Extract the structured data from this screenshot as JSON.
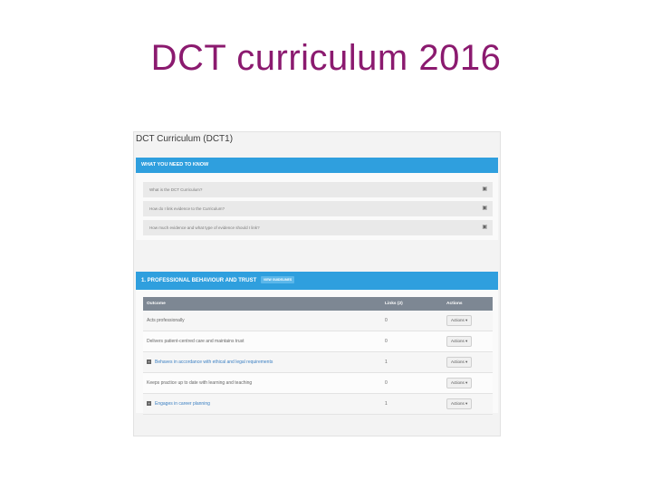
{
  "slide": {
    "title": "DCT curriculum 2016"
  },
  "page": {
    "heading": "DCT Curriculum (DCT1)"
  },
  "section1": {
    "title": "WHAT YOU NEED TO KNOW",
    "items": [
      {
        "label": "What is the DCT Curriculum?"
      },
      {
        "label": "How do I link evidence to the Curriculum?"
      },
      {
        "label": "How much evidence and what type of evidence should I link?"
      }
    ]
  },
  "section2": {
    "title": "1. PROFESSIONAL BEHAVIOUR AND TRUST",
    "badge": "VIEW GUIDELINES",
    "columns": {
      "outcome": "Outcome",
      "links": "Links (2)",
      "actions": "Actions"
    },
    "rows": [
      {
        "outcome": "Acts professionally",
        "links": "0",
        "action": "Actions ▾",
        "expandable": false
      },
      {
        "outcome": "Delivers patient-centred care and maintains trust",
        "links": "0",
        "action": "Actions ▾",
        "expandable": false
      },
      {
        "outcome": "Behaves in accordance with ethical and legal requirements",
        "links": "1",
        "action": "Actions ▾",
        "expandable": true
      },
      {
        "outcome": "Keeps practice up to date with learning and teaching",
        "links": "0",
        "action": "Actions ▾",
        "expandable": false
      },
      {
        "outcome": "Engages in career planning",
        "links": "1",
        "action": "Actions ▾",
        "expandable": true
      }
    ]
  },
  "icons": {
    "expand": "plus-square-icon",
    "faq_toggle": "plus-icon"
  },
  "colors": {
    "title": "#8b1a6f",
    "panel_header": "#2f9fde",
    "table_header": "#7d8793"
  }
}
